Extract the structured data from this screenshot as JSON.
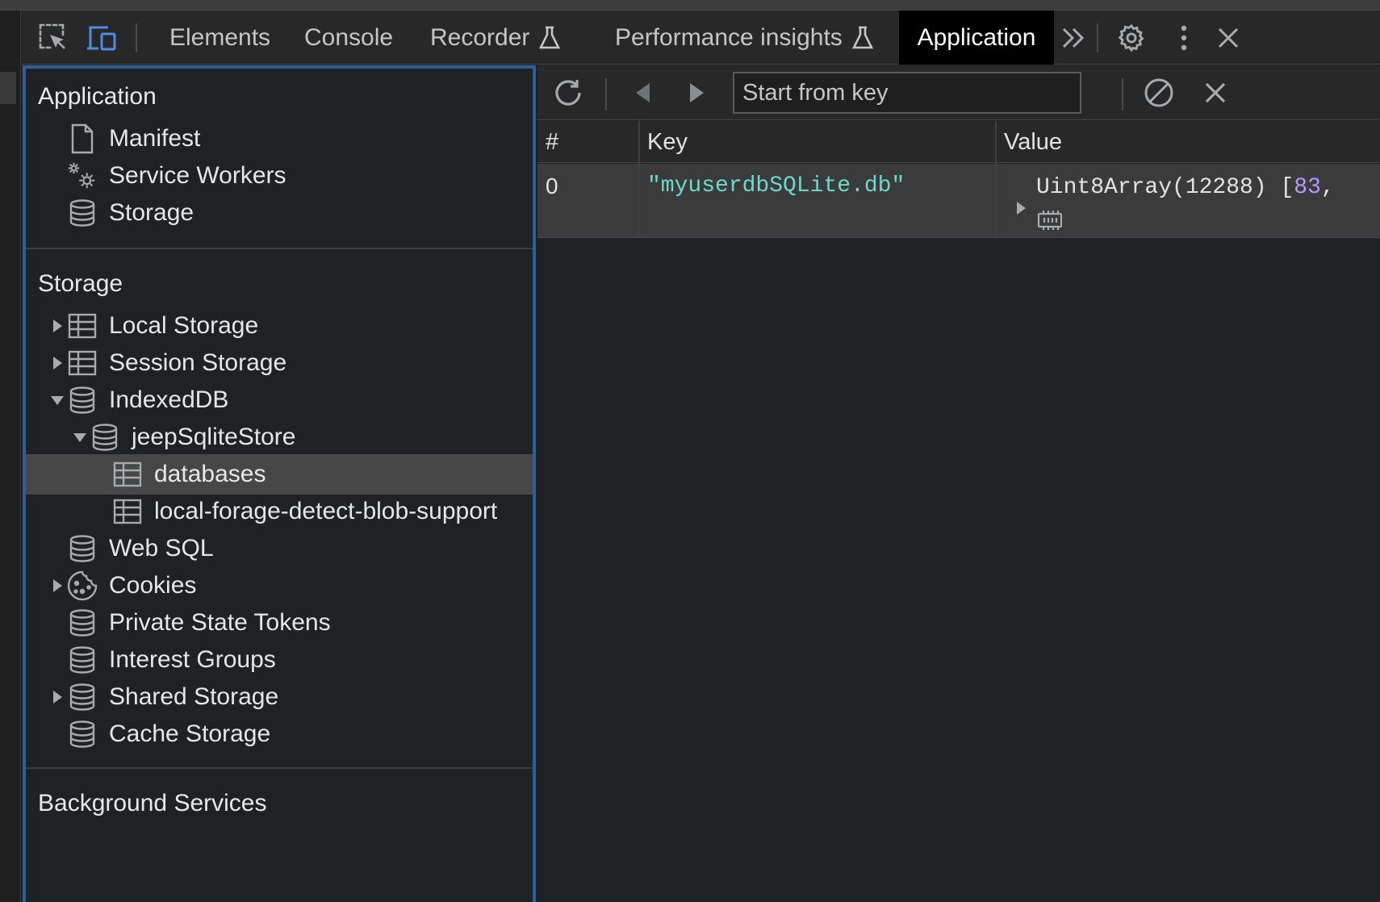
{
  "tabs": [
    {
      "label": "Elements",
      "active": false
    },
    {
      "label": "Console",
      "active": false
    },
    {
      "label": "Recorder",
      "active": false,
      "experimental": true
    },
    {
      "label": "Performance insights",
      "active": false,
      "experimental": true
    },
    {
      "label": "Application",
      "active": true
    }
  ],
  "icons": {
    "inspect": "inspect-element-icon",
    "device": "device-toolbar-icon",
    "more_tabs": "chevron-double-right-icon",
    "settings": "gear-icon",
    "menu": "kebab-menu-icon",
    "close": "close-icon"
  },
  "colors": {
    "accent_border": "#2e5f97",
    "string_value": "#6fd9c9",
    "number_value": "#b39cff",
    "selected_row": "#474747"
  },
  "sidebar": {
    "application": {
      "title": "Application",
      "items": [
        {
          "label": "Manifest",
          "icon": "document-icon"
        },
        {
          "label": "Service Workers",
          "icon": "gears-icon"
        },
        {
          "label": "Storage",
          "icon": "database-icon"
        }
      ]
    },
    "storage": {
      "title": "Storage",
      "local_storage": "Local Storage",
      "session_storage": "Session Storage",
      "indexeddb": "IndexedDB",
      "db_name": "jeepSqliteStore",
      "store_databases": "databases",
      "store_blob": "local-forage-detect-blob-support",
      "web_sql": "Web SQL",
      "cookies": "Cookies",
      "private_state_tokens": "Private State Tokens",
      "interest_groups": "Interest Groups",
      "shared_storage": "Shared Storage",
      "cache_storage": "Cache Storage"
    },
    "background": {
      "title": "Background Services"
    }
  },
  "toolbar": {
    "key_placeholder": "Start from key"
  },
  "table": {
    "headers": {
      "index": "#",
      "key": "Key",
      "value": "Value"
    },
    "rows": [
      {
        "index": "0",
        "key": "\"myuserdbSQLite.db\"",
        "value_prefix": "Uint8Array(12288) [",
        "value_first": "83",
        "value_suffix": ","
      }
    ]
  }
}
